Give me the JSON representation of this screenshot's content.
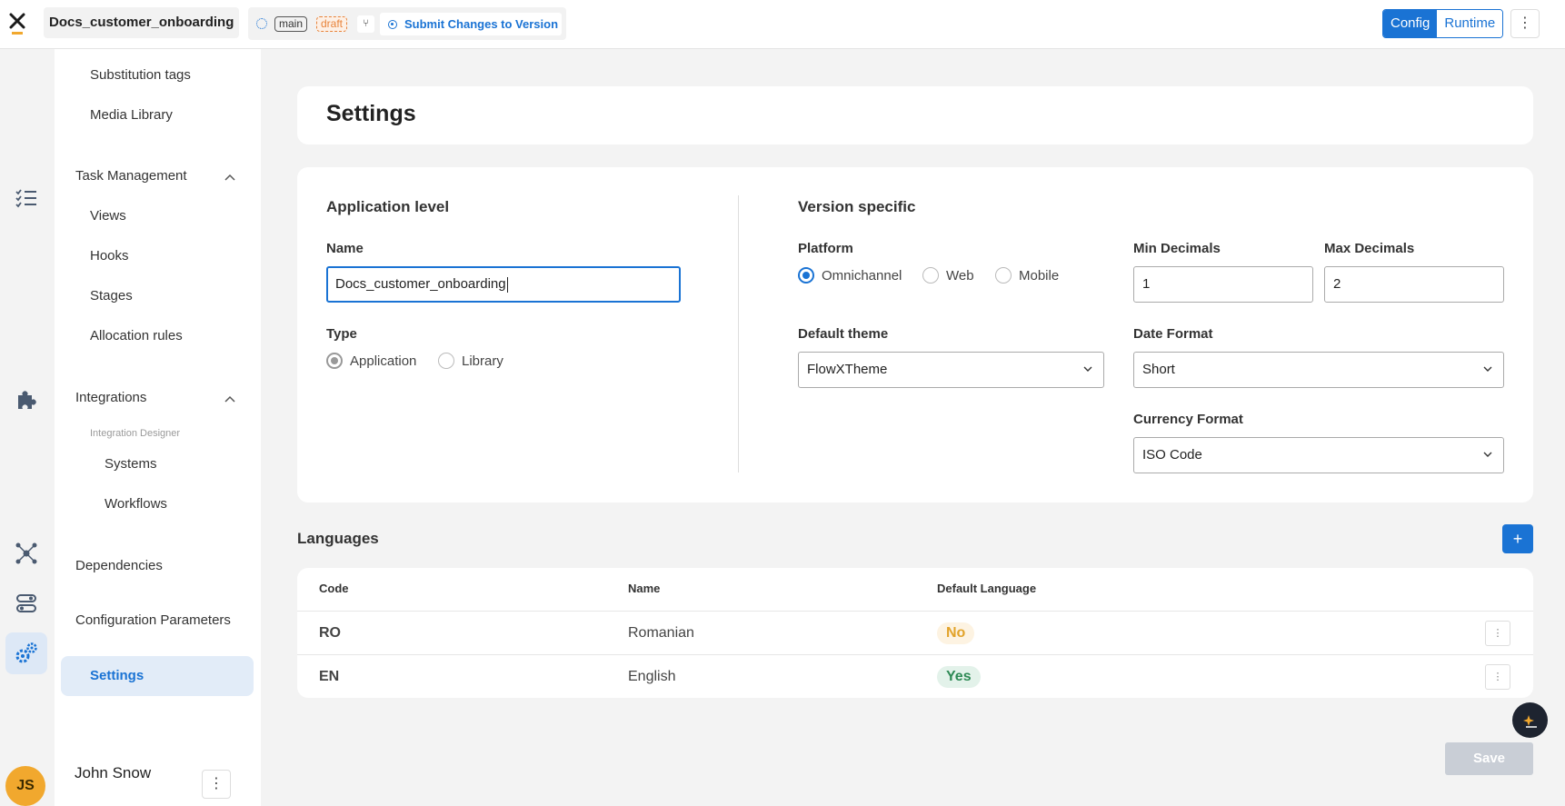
{
  "app": {
    "name": "Docs_customer_onboarding"
  },
  "version_bar": {
    "branch_tag": "main",
    "status_tag": "draft",
    "submit_label": "Submit Changes to Version"
  },
  "mode_toggle": {
    "config_label": "Config",
    "runtime_label": "Runtime",
    "selected": "Config"
  },
  "rail_icons": [
    "task-list-icon",
    "puzzle-icon",
    "dependencies-icon",
    "config-params-icon",
    "settings-gear-icon"
  ],
  "sidebar": {
    "items": [
      {
        "label": "Substitution tags"
      },
      {
        "label": "Media Library"
      },
      {
        "label": "Task Management"
      },
      {
        "label": "Views"
      },
      {
        "label": "Hooks"
      },
      {
        "label": "Stages"
      },
      {
        "label": "Allocation rules"
      },
      {
        "label": "Integrations"
      },
      {
        "label": "Integration Designer"
      },
      {
        "label": "Systems"
      },
      {
        "label": "Workflows"
      },
      {
        "label": "Dependencies"
      },
      {
        "label": "Configuration Parameters"
      },
      {
        "label": "Settings"
      }
    ],
    "active": "Settings"
  },
  "user": {
    "initials": "JS",
    "name": "John Snow"
  },
  "page": {
    "title": "Settings"
  },
  "application_level": {
    "heading": "Application level",
    "name_label": "Name",
    "name_value": "Docs_customer_onboarding",
    "type_label": "Type",
    "type_options": [
      "Application",
      "Library"
    ],
    "type_selected": "Application"
  },
  "version_specific": {
    "heading": "Version specific",
    "platform_label": "Platform",
    "platform_options": [
      "Omnichannel",
      "Web",
      "Mobile"
    ],
    "platform_selected": "Omnichannel",
    "min_decimals_label": "Min Decimals",
    "min_decimals_value": "1",
    "max_decimals_label": "Max Decimals",
    "max_decimals_value": "2",
    "default_theme_label": "Default theme",
    "default_theme_value": "FlowXTheme",
    "date_format_label": "Date Format",
    "date_format_value": "Short",
    "currency_format_label": "Currency Format",
    "currency_format_value": "ISO Code"
  },
  "languages": {
    "title": "Languages",
    "add_label": "+",
    "columns": [
      "Code",
      "Name",
      "Default Language"
    ],
    "rows": [
      {
        "code": "RO",
        "name": "Romanian",
        "default": "No"
      },
      {
        "code": "EN",
        "name": "English",
        "default": "Yes"
      }
    ]
  },
  "actions": {
    "save_label": "Save"
  },
  "colors": {
    "accent": "#1a73d4",
    "badge_no_text": "#e2a32a",
    "badge_yes_text": "#2e8a55",
    "avatar": "#f1a82e"
  }
}
